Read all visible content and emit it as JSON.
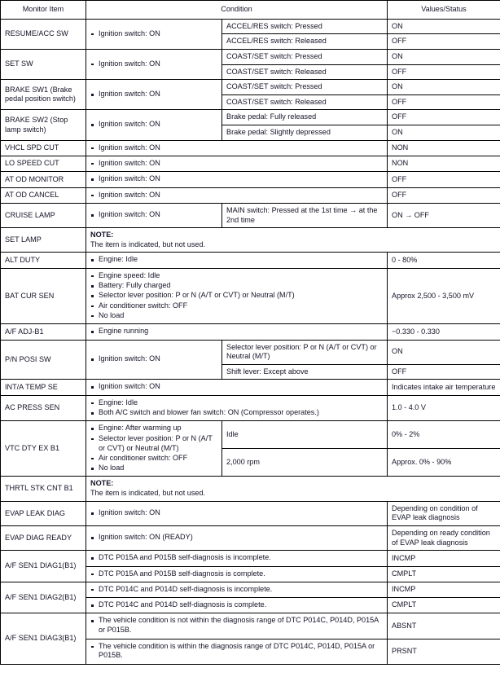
{
  "table": {
    "headers": {
      "monitor_item": "Monitor Item",
      "condition": "Condition",
      "values_status": "Values/Status"
    },
    "note_label": "NOTE:",
    "rows": [
      {
        "item": "RESUME/ACC SW",
        "cond_main": [
          "Ignition switch: ON"
        ],
        "subs": [
          {
            "cond": "ACCEL/RES switch: Pressed",
            "value": "ON"
          },
          {
            "cond": "ACCEL/RES switch: Released",
            "value": "OFF"
          }
        ]
      },
      {
        "item": "SET SW",
        "cond_main": [
          "Ignition switch: ON"
        ],
        "subs": [
          {
            "cond": "COAST/SET switch: Pressed",
            "value": "ON"
          },
          {
            "cond": "COAST/SET switch: Released",
            "value": "OFF"
          }
        ]
      },
      {
        "item": "BRAKE SW1 (Brake pedal position switch)",
        "cond_main": [
          "Ignition switch: ON"
        ],
        "subs": [
          {
            "cond": "COAST/SET switch: Pressed",
            "value": "ON"
          },
          {
            "cond": "COAST/SET switch: Released",
            "value": "OFF"
          }
        ]
      },
      {
        "item": "BRAKE SW2 (Stop lamp switch)",
        "cond_main": [
          "Ignition switch: ON"
        ],
        "subs": [
          {
            "cond": "Brake pedal: Fully released",
            "value": "OFF"
          },
          {
            "cond": "Brake pedal: Slightly depressed",
            "value": "ON"
          }
        ]
      },
      {
        "item": "VHCL SPD CUT",
        "cond_main": [
          "Ignition switch: ON"
        ],
        "cond_span": true,
        "value": "NON"
      },
      {
        "item": "LO SPEED CUT",
        "cond_main": [
          "Ignition switch: ON"
        ],
        "cond_span": true,
        "value": "NON"
      },
      {
        "item": "AT OD MONITOR",
        "cond_main": [
          "Ignition switch: ON"
        ],
        "cond_span": true,
        "value": "OFF"
      },
      {
        "item": "AT OD CANCEL",
        "cond_main": [
          "Ignition switch: ON"
        ],
        "cond_span": true,
        "value": "OFF"
      },
      {
        "item": "CRUISE LAMP",
        "cond_main": [
          "Ignition switch: ON"
        ],
        "subs": [
          {
            "cond": "MAIN switch: Pressed at the 1st time → at the 2nd time",
            "value": "ON → OFF"
          }
        ]
      },
      {
        "item": "SET LAMP",
        "note": "The item is indicated, but not used."
      },
      {
        "item": "ALT DUTY",
        "cond_main": [
          "Engine: Idle"
        ],
        "cond_span": true,
        "value": "0 - 80%"
      },
      {
        "item": "BAT CUR SEN",
        "cond_main": [
          "Engine speed: Idle",
          "Battery: Fully charged",
          "Selector lever position: P or N (A/T or CVT) or Neutral (M/T)",
          "Air conditioner switch: OFF",
          "No load"
        ],
        "cond_span": true,
        "value": "Approx 2,500 - 3,500 mV"
      },
      {
        "item": "A/F ADJ-B1",
        "cond_main": [
          "Engine running"
        ],
        "cond_span": true,
        "value": "−0.330 - 0.330"
      },
      {
        "item": "P/N POSI SW",
        "cond_main": [
          "Ignition switch: ON"
        ],
        "subs": [
          {
            "cond": "Selector lever position: P or N (A/T or CVT) or Neutral (M/T)",
            "value": "ON"
          },
          {
            "cond": "Shift lever: Except above",
            "value": "OFF"
          }
        ]
      },
      {
        "item": "INT/A TEMP SE",
        "cond_main": [
          "Ignition switch: ON"
        ],
        "cond_span": true,
        "value": "Indicates intake air temperature"
      },
      {
        "item": "AC PRESS SEN",
        "cond_main": [
          "Engine: Idle",
          "Both A/C switch and blower fan switch: ON (Compressor operates.)"
        ],
        "cond_span": true,
        "value": "1.0 - 4.0 V"
      },
      {
        "item": "VTC DTY EX B1",
        "cond_main": [
          "Engine: After warming up",
          "Selector lever position: P or N (A/T or CVT) or Neutral (M/T)",
          "Air conditioner switch: OFF",
          "No load"
        ],
        "subs": [
          {
            "cond": "Idle",
            "value": "0% - 2%"
          },
          {
            "cond": "2,000 rpm",
            "value": "Approx. 0% - 90%"
          }
        ]
      },
      {
        "item": "THRTL STK CNT B1",
        "note": "The item is indicated, but not used."
      },
      {
        "item": "EVAP LEAK DIAG",
        "cond_main": [
          "Ignition switch: ON"
        ],
        "cond_span": true,
        "value": "Depending on condition of EVAP leak diagnosis"
      },
      {
        "item": "EVAP DIAG READY",
        "cond_main": [
          "Ignition switch: ON (READY)"
        ],
        "cond_span": true,
        "value": "Depending on ready condition of EVAP leak diagnosis"
      },
      {
        "item": "A/F SEN1 DIAG1(B1)",
        "rows_bullet": [
          {
            "cond": "DTC P015A and P015B self-diagnosis is incomplete.",
            "value": "INCMP"
          },
          {
            "cond": "DTC P015A and P015B self-diagnosis is complete.",
            "value": "CMPLT"
          }
        ]
      },
      {
        "item": "A/F SEN1 DIAG2(B1)",
        "rows_bullet": [
          {
            "cond": "DTC P014C and P014D self-diagnosis is incomplete.",
            "value": "INCMP"
          },
          {
            "cond": "DTC P014C and P014D self-diagnosis is complete.",
            "value": "CMPLT"
          }
        ]
      },
      {
        "item": "A/F SEN1 DIAG3(B1)",
        "rows_bullet": [
          {
            "cond": "The vehicle condition is not within the diagnosis range of DTC P014C, P014D, P015A or P015B.",
            "value": "ABSNT"
          },
          {
            "cond": "The vehicle condition is within the diagnosis range of DTC P014C, P014D, P015A or P015B.",
            "value": "PRSNT"
          }
        ]
      }
    ]
  }
}
